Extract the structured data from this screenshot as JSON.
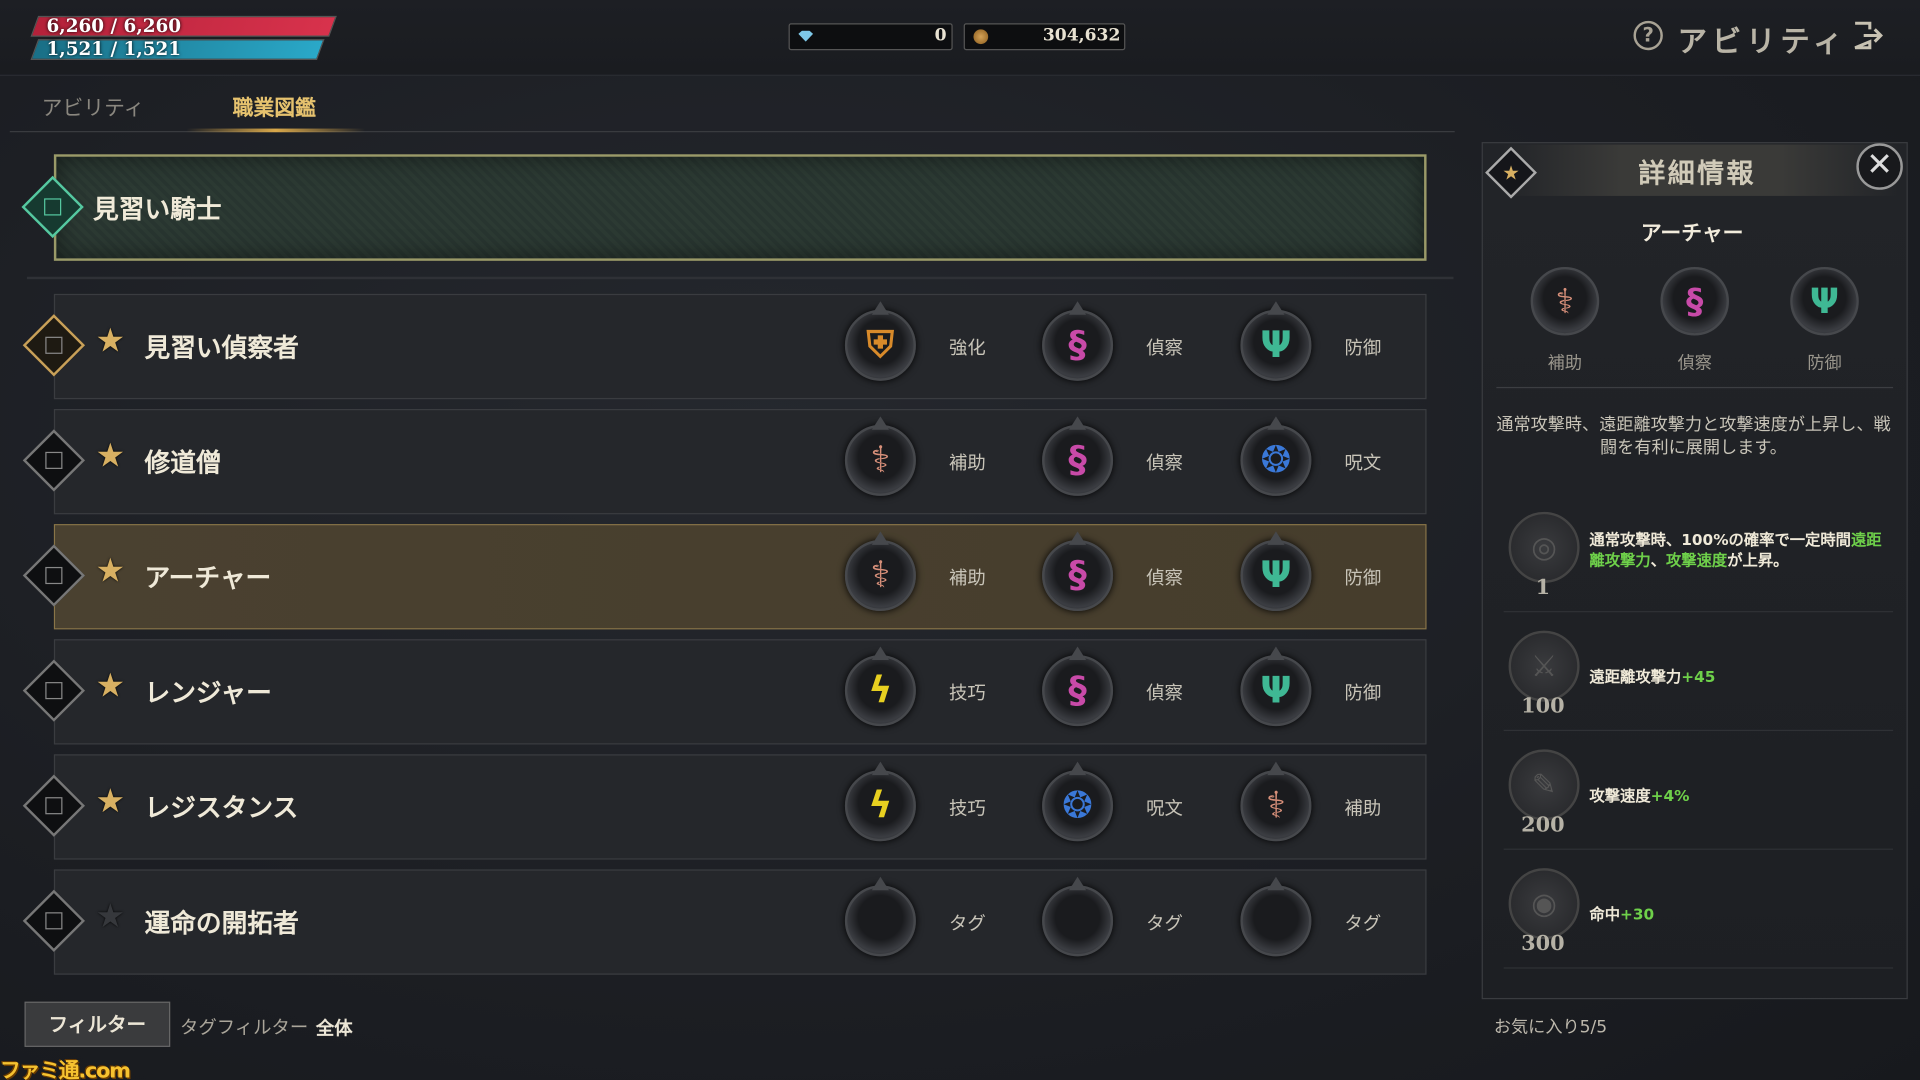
{
  "status": {
    "hp": "6,260 / 6,260",
    "mp": "1,521 / 1,521",
    "gems": "0",
    "gold": "304,632"
  },
  "header": {
    "help_icon": "?",
    "title": "アビリティ",
    "exit_icon": "exit-icon"
  },
  "tabs": [
    {
      "label": "アビリティ"
    },
    {
      "label": "職業図鑑"
    }
  ],
  "top_class": {
    "name": "見習い騎士"
  },
  "classes": [
    {
      "name": "見習い偵察者",
      "starred": true,
      "tags": [
        {
          "icon": "shield-helm",
          "label": "強化",
          "color": "#d88a2a"
        },
        {
          "icon": "dagger-snake",
          "label": "偵察",
          "color": "#c84aa8"
        },
        {
          "icon": "spear-wings",
          "label": "防御",
          "color": "#3fb894"
        }
      ]
    },
    {
      "name": "修道僧",
      "starred": true,
      "tags": [
        {
          "icon": "staff-wings",
          "label": "補助",
          "color": "#d8907a"
        },
        {
          "icon": "dagger-snake",
          "label": "偵察",
          "color": "#c84aa8"
        },
        {
          "icon": "orb-flame",
          "label": "呪文",
          "color": "#3a78d8"
        }
      ]
    },
    {
      "name": "アーチャー",
      "starred": true,
      "selected": true,
      "tags": [
        {
          "icon": "staff-wings",
          "label": "補助",
          "color": "#d8907a"
        },
        {
          "icon": "dagger-snake",
          "label": "偵察",
          "color": "#c84aa8"
        },
        {
          "icon": "spear-wings",
          "label": "防御",
          "color": "#3fb894"
        }
      ]
    },
    {
      "name": "レンジャー",
      "starred": true,
      "tags": [
        {
          "icon": "lightning-wing",
          "label": "技巧",
          "color": "#e8d020"
        },
        {
          "icon": "dagger-snake",
          "label": "偵察",
          "color": "#c84aa8"
        },
        {
          "icon": "spear-wings",
          "label": "防御",
          "color": "#3fb894"
        }
      ]
    },
    {
      "name": "レジスタンス",
      "starred": true,
      "tags": [
        {
          "icon": "lightning-wing",
          "label": "技巧",
          "color": "#e8d020"
        },
        {
          "icon": "orb-flame",
          "label": "呪文",
          "color": "#3a78d8"
        },
        {
          "icon": "staff-wings",
          "label": "補助",
          "color": "#d8907a"
        }
      ]
    },
    {
      "name": "運命の開拓者",
      "starred": false,
      "tags": [
        {
          "icon": "empty",
          "label": "タグ",
          "color": "#222"
        },
        {
          "icon": "empty",
          "label": "タグ",
          "color": "#222"
        },
        {
          "icon": "empty",
          "label": "タグ",
          "color": "#222"
        }
      ]
    }
  ],
  "footer": {
    "filter_label": "フィルター",
    "tag_filter_label": "タグフィルター",
    "tag_filter_value": "全体",
    "favorites": "お気に入り5/5",
    "watermark": "ファミ通.com"
  },
  "detail": {
    "title": "詳細情報",
    "class_name": "アーチャー",
    "tags": [
      {
        "label": "補助",
        "color": "#d8907a"
      },
      {
        "label": "偵察",
        "color": "#c84aa8"
      },
      {
        "label": "防御",
        "color": "#3fb894"
      }
    ],
    "description": "通常攻撃時、遠距離攻撃力と攻撃速度が上昇し、戦闘を有利に展開します。",
    "skills": [
      {
        "level": "1",
        "parts": [
          "通常攻撃時、100%の確率で一定時間",
          "遠距離攻撃力",
          "、",
          "攻撃速度",
          "が上昇。"
        ]
      },
      {
        "level": "100",
        "parts": [
          "遠距離攻撃力",
          "+45"
        ]
      },
      {
        "level": "200",
        "parts": [
          "攻撃速度",
          "+4%"
        ]
      },
      {
        "level": "300",
        "parts": [
          "命中",
          "+30"
        ]
      }
    ]
  }
}
